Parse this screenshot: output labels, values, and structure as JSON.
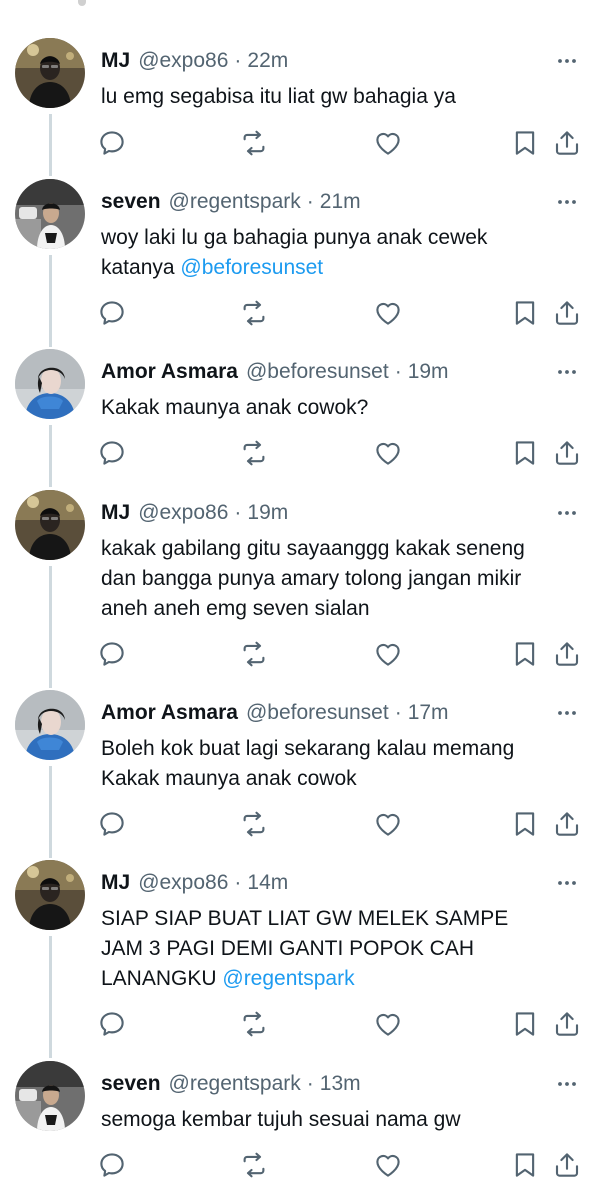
{
  "tweets": [
    {
      "name": "MJ",
      "handle": "@expo86",
      "sep": "·",
      "time": "22m",
      "text": "lu emg segabisa itu liat gw bahagia ya",
      "mention": "",
      "avatar": "avatar-mj"
    },
    {
      "name": "seven",
      "handle": "@regentspark",
      "sep": "·",
      "time": "21m",
      "text": "woy laki lu ga bahagia punya anak cewek katanya",
      "mention": "@beforesunset",
      "avatar": "avatar-seven"
    },
    {
      "name": "Amor Asmara",
      "handle": "@beforesunset",
      "sep": "·",
      "time": "19m",
      "text": "Kakak maunya anak cowok?",
      "mention": "",
      "avatar": "avatar-amor"
    },
    {
      "name": "MJ",
      "handle": "@expo86",
      "sep": "·",
      "time": "19m",
      "text": "kakak gabilang gitu sayaanggg kakak seneng dan bangga punya amary tolong jangan mikir aneh aneh emg seven sialan",
      "mention": "",
      "avatar": "avatar-mj"
    },
    {
      "name": "Amor Asmara",
      "handle": "@beforesunset",
      "sep": "·",
      "time": "17m",
      "text": "Boleh kok buat lagi sekarang kalau memang Kakak maunya anak cowok",
      "mention": "",
      "avatar": "avatar-amor"
    },
    {
      "name": "MJ",
      "handle": "@expo86",
      "sep": "·",
      "time": "14m",
      "text": "SIAP SIAP BUAT LIAT GW MELEK SAMPE JAM 3 PAGI DEMI GANTI POPOK CAH LANANGKU",
      "mention": "@regentspark",
      "avatar": "avatar-mj"
    },
    {
      "name": "seven",
      "handle": "@regentspark",
      "sep": "·",
      "time": "13m",
      "text": "semoga kembar tujuh sesuai nama gw",
      "mention": "",
      "avatar": "avatar-seven"
    }
  ],
  "icons": {
    "reply": "reply-icon",
    "retweet": "retweet-icon",
    "like": "like-icon",
    "bookmark": "bookmark-icon",
    "share": "share-icon",
    "more": "more-icon"
  },
  "colors": {
    "text": "#0f1419",
    "secondary": "#536471",
    "link": "#1d9bf0",
    "thread_line": "#cfd9de"
  }
}
